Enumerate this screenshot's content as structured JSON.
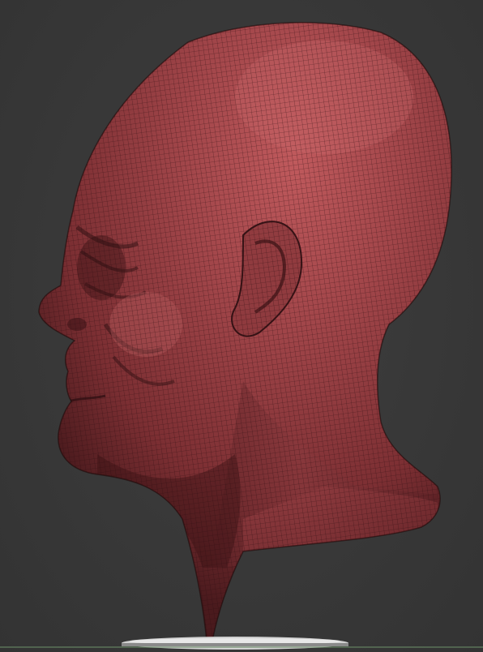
{
  "viewport": {
    "background_color": "#3a3a3a",
    "model": {
      "subject": "sculpted-head-bust-profile",
      "material_color": "#9a3a3f",
      "wire_color": "#2a0d10",
      "base_color": "#b8b8b8",
      "polyframe": true
    }
  }
}
